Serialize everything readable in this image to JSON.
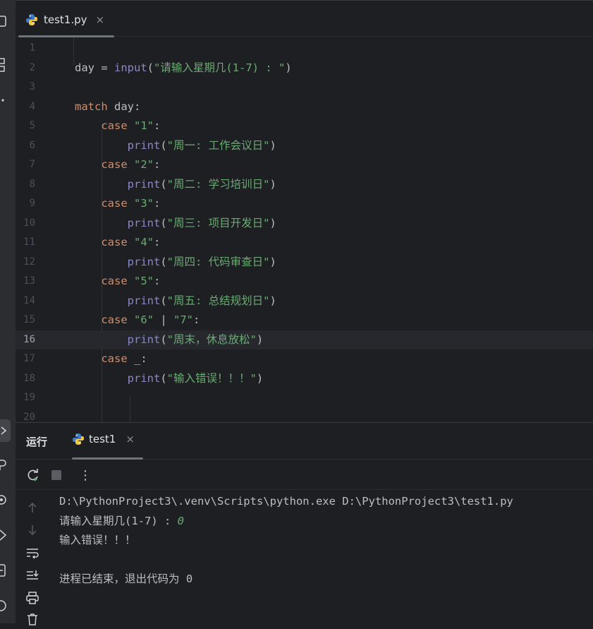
{
  "editor_tab": {
    "label": "test1.py",
    "close": "×"
  },
  "editor": {
    "current_line": 16,
    "lines": [
      {
        "n": "1",
        "tokens": []
      },
      {
        "n": "2",
        "tokens": [
          [
            "day = ",
            "op"
          ],
          [
            "input",
            "bi"
          ],
          [
            "(",
            "op"
          ],
          [
            "\"请输入星期几(1-7) : \"",
            "str"
          ],
          [
            ")",
            "op"
          ]
        ]
      },
      {
        "n": "3",
        "tokens": []
      },
      {
        "n": "4",
        "tokens": [
          [
            "match",
            "kw"
          ],
          [
            " day:",
            "op"
          ]
        ]
      },
      {
        "n": "5",
        "tokens": [
          [
            "    ",
            "op"
          ],
          [
            "case",
            "kw"
          ],
          [
            " ",
            "op"
          ],
          [
            "\"1\"",
            "str"
          ],
          [
            ":",
            "op"
          ]
        ]
      },
      {
        "n": "6",
        "tokens": [
          [
            "        ",
            "op"
          ],
          [
            "print",
            "bi"
          ],
          [
            "(",
            "op"
          ],
          [
            "\"周一: 工作会议日\"",
            "str"
          ],
          [
            ")",
            "op"
          ]
        ]
      },
      {
        "n": "7",
        "tokens": [
          [
            "    ",
            "op"
          ],
          [
            "case",
            "kw"
          ],
          [
            " ",
            "op"
          ],
          [
            "\"2\"",
            "str"
          ],
          [
            ":",
            "op"
          ]
        ]
      },
      {
        "n": "8",
        "tokens": [
          [
            "        ",
            "op"
          ],
          [
            "print",
            "bi"
          ],
          [
            "(",
            "op"
          ],
          [
            "\"周二: 学习培训日\"",
            "str"
          ],
          [
            ")",
            "op"
          ]
        ]
      },
      {
        "n": "9",
        "tokens": [
          [
            "    ",
            "op"
          ],
          [
            "case",
            "kw"
          ],
          [
            " ",
            "op"
          ],
          [
            "\"3\"",
            "str"
          ],
          [
            ":",
            "op"
          ]
        ]
      },
      {
        "n": "10",
        "tokens": [
          [
            "        ",
            "op"
          ],
          [
            "print",
            "bi"
          ],
          [
            "(",
            "op"
          ],
          [
            "\"周三: 项目开发日\"",
            "str"
          ],
          [
            ")",
            "op"
          ]
        ]
      },
      {
        "n": "11",
        "tokens": [
          [
            "    ",
            "op"
          ],
          [
            "case",
            "kw"
          ],
          [
            " ",
            "op"
          ],
          [
            "\"4\"",
            "str"
          ],
          [
            ":",
            "op"
          ]
        ]
      },
      {
        "n": "12",
        "tokens": [
          [
            "        ",
            "op"
          ],
          [
            "print",
            "bi"
          ],
          [
            "(",
            "op"
          ],
          [
            "\"周四: 代码审查日\"",
            "str"
          ],
          [
            ")",
            "op"
          ]
        ]
      },
      {
        "n": "13",
        "tokens": [
          [
            "    ",
            "op"
          ],
          [
            "case",
            "kw"
          ],
          [
            " ",
            "op"
          ],
          [
            "\"5\"",
            "str"
          ],
          [
            ":",
            "op"
          ]
        ]
      },
      {
        "n": "14",
        "tokens": [
          [
            "        ",
            "op"
          ],
          [
            "print",
            "bi"
          ],
          [
            "(",
            "op"
          ],
          [
            "\"周五: 总结规划日\"",
            "str"
          ],
          [
            ")",
            "op"
          ]
        ]
      },
      {
        "n": "15",
        "tokens": [
          [
            "    ",
            "op"
          ],
          [
            "case",
            "kw"
          ],
          [
            " ",
            "op"
          ],
          [
            "\"6\"",
            "str"
          ],
          [
            " | ",
            "op"
          ],
          [
            "\"7\"",
            "str"
          ],
          [
            ":",
            "op"
          ]
        ]
      },
      {
        "n": "16",
        "tokens": [
          [
            "        ",
            "op"
          ],
          [
            "print",
            "bi"
          ],
          [
            "(",
            "op"
          ],
          [
            "\"周末，休息放松\"",
            "str"
          ],
          [
            ")",
            "op"
          ]
        ]
      },
      {
        "n": "17",
        "tokens": [
          [
            "    ",
            "op"
          ],
          [
            "case",
            "kw"
          ],
          [
            " _:",
            "op"
          ]
        ]
      },
      {
        "n": "18",
        "tokens": [
          [
            "        ",
            "op"
          ],
          [
            "print",
            "bi"
          ],
          [
            "(",
            "op"
          ],
          [
            "\"输入错误！！！\"",
            "str"
          ],
          [
            ")",
            "op"
          ]
        ]
      },
      {
        "n": "19",
        "tokens": []
      },
      {
        "n": "20",
        "tokens": []
      }
    ]
  },
  "run_panel": {
    "title": "运行",
    "tab_label": "test1",
    "tab_close": "×",
    "more_label": "⋮",
    "console": {
      "command": "D:\\PythonProject3\\.venv\\Scripts\\python.exe D:\\PythonProject3\\test1.py",
      "prompt": "请输入星期几(1-7) : ",
      "user_input": "0",
      "output": "输入错误！！！",
      "exit_message": "进程已结束，退出代码为 0"
    }
  },
  "icons": {
    "strip": [
      "project-icon",
      "structure-icon",
      "more-icon",
      "run-icon",
      "python-packages-icon",
      "services-icon",
      "python-console-icon",
      "terminal-icon",
      "problems-icon"
    ],
    "toolbar": [
      "rerun-icon",
      "stop-icon",
      "more-icon"
    ],
    "side": [
      "scroll-up-icon",
      "scroll-down-icon",
      "soft-wrap-icon",
      "scroll-to-end-icon",
      "print-icon",
      "clear-all-icon"
    ]
  },
  "colors": {
    "background": "#1e1f22",
    "keyword": "#cf8e6d",
    "builtin": "#8888c6",
    "string": "#6aab73",
    "current_line": "#26282e"
  }
}
